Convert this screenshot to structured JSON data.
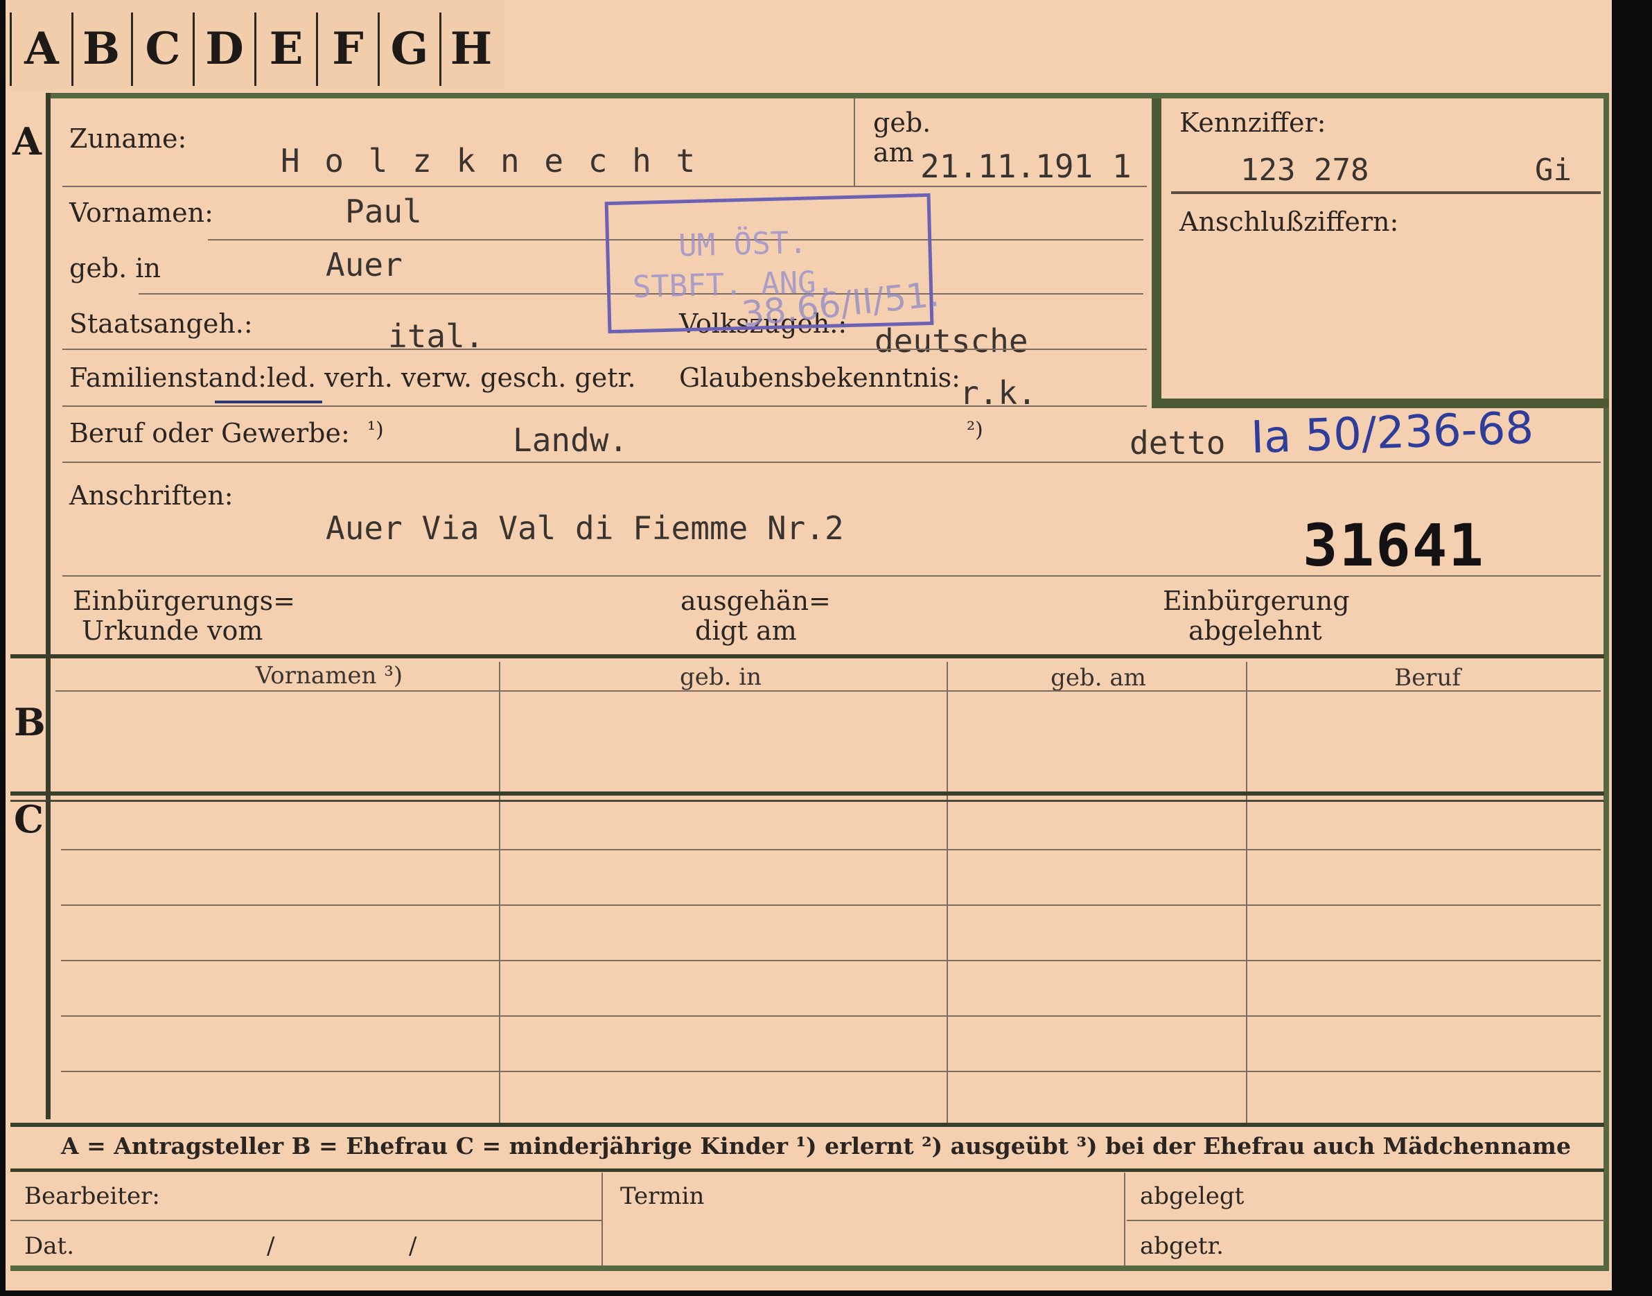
{
  "tabs": [
    "A",
    "B",
    "C",
    "D",
    "E",
    "F",
    "G",
    "H"
  ],
  "sections": {
    "a": "A",
    "b": "B",
    "c": "C"
  },
  "labels": {
    "zuname": "Zuname:",
    "geb": "geb.",
    "am": "am",
    "kennziffer": "Kennziffer:",
    "vornamen": "Vornamen:",
    "anschlussziffern": "Anschlußziffern:",
    "geb_in": "geb. in",
    "staatsangeh": "Staatsangeh.:",
    "volkszugeh": "Volkszugeh.:",
    "familienstand": "Familienstand:",
    "familienstand_options": "led. verh. verw. gesch. getr.",
    "glaubensbekenntnis": "Glaubensbekenntnis:",
    "beruf": "Beruf oder Gewerbe:",
    "fn1": "¹)",
    "fn2": "²)",
    "anschriften": "Anschriften:",
    "einbuergerungsurkunde_1": "Einbürgerungs=",
    "einbuergerungsurkunde_2": "Urkunde vom",
    "ausgehaendigt_1": "ausgehän=",
    "ausgehaendigt_2": "digt am",
    "einbuergerung_abgelehnt_1": "Einbürgerung",
    "einbuergerung_abgelehnt_2": "abgelehnt"
  },
  "values": {
    "zuname": "H o l z k n e c h t",
    "geb_am": "21.11.191 1",
    "kennziffer": "123 278",
    "kennziffer_suffix": "Gi",
    "vornamen": "Paul",
    "geb_in": "Auer",
    "staatsangeh": "ital.",
    "volkszugeh": "deutsche",
    "glaubensbekenntnis": "r.k.",
    "beruf": "Landw.",
    "detto": "detto",
    "handwritten_ref": "Ia 50/236-68",
    "anschrift": "Auer Via Val di Fiemme Nr.2",
    "stamp_number": "31641"
  },
  "stamp": {
    "line1": "UM ÖST.",
    "line2": "STBFT. ANG.",
    "overwrite": "38.66/II/51."
  },
  "table": {
    "headers": [
      "Vornamen ³)",
      "geb. in",
      "geb. am",
      "Beruf"
    ]
  },
  "legend": "A = Antragsteller   B = Ehefrau   C = minderjährige Kinder   ¹) erlernt   ²) ausgeübt   ³) bei der Ehefrau auch Mädchenname",
  "footer": {
    "bearbeiter": "Bearbeiter:",
    "termin": "Termin",
    "abgelegt": "abgelegt",
    "dat": "Dat.",
    "slash1": "/",
    "slash2": "/",
    "abgetr": "abgetr."
  },
  "colors": {
    "paper": "#f4d0b0",
    "stamp": "#6b62b6",
    "ink_blue": "#2e3d9a",
    "border_green": "#55683f"
  }
}
